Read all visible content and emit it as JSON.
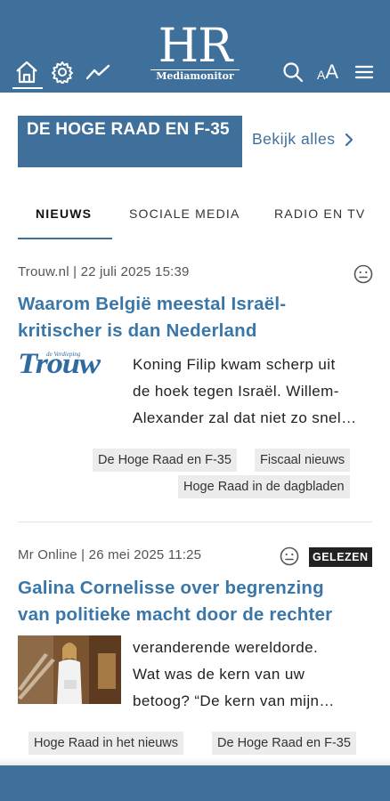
{
  "header": {
    "logo_main": "HR",
    "logo_sub": "Mediamonitor",
    "font_size_label": "AA"
  },
  "section": {
    "title": "DE HOGE RAAD EN F-35",
    "see_all": "Bekijk alles"
  },
  "tabs": [
    {
      "label": "NIEUWS",
      "active": true
    },
    {
      "label": "SOCIALE MEDIA",
      "active": false
    },
    {
      "label": "RADIO EN TV",
      "active": false
    }
  ],
  "articles": [
    {
      "meta": "Trouw.nl | 22 juli 2025 15:39",
      "title_lines": [
        "Waarom België meestal Israël-",
        "kritischer is dan Nederland"
      ],
      "logo_text": "Trouw",
      "logo_tagline": "de Verdieping",
      "excerpt_lines": [
        "Koning Filip kwam scherp uit",
        "de hoek tegen Israël. Willem-",
        "Alexander zal dat niet zo snel…"
      ],
      "tags": [
        "De Hoge Raad en F-35",
        "Fiscaal nieuws",
        "Hoge Raad in de dagbladen"
      ],
      "read": false
    },
    {
      "meta": "Mr Online | 26 mei 2025 11:25",
      "badge": "GELEZEN",
      "title_lines": [
        "Galina Cornelisse over begrenzing",
        "van politieke macht door de rechter"
      ],
      "excerpt_lines": [
        "veranderende wereldorde.",
        "Wat was de kern van uw",
        "betoog? “De kern van mijn…"
      ],
      "tags": [
        "Hoge Raad in het nieuws",
        "De Hoge Raad en F-35"
      ],
      "read": true
    }
  ],
  "colors": {
    "brand": "#3f6f9b",
    "title": "#3a77a8",
    "tag_bg": "#ececec"
  },
  "icons": [
    "home-icon",
    "gear-icon",
    "trend-icon",
    "search-icon",
    "font-size-icon",
    "menu-icon",
    "chevron-right-icon",
    "neutral-face-icon"
  ]
}
